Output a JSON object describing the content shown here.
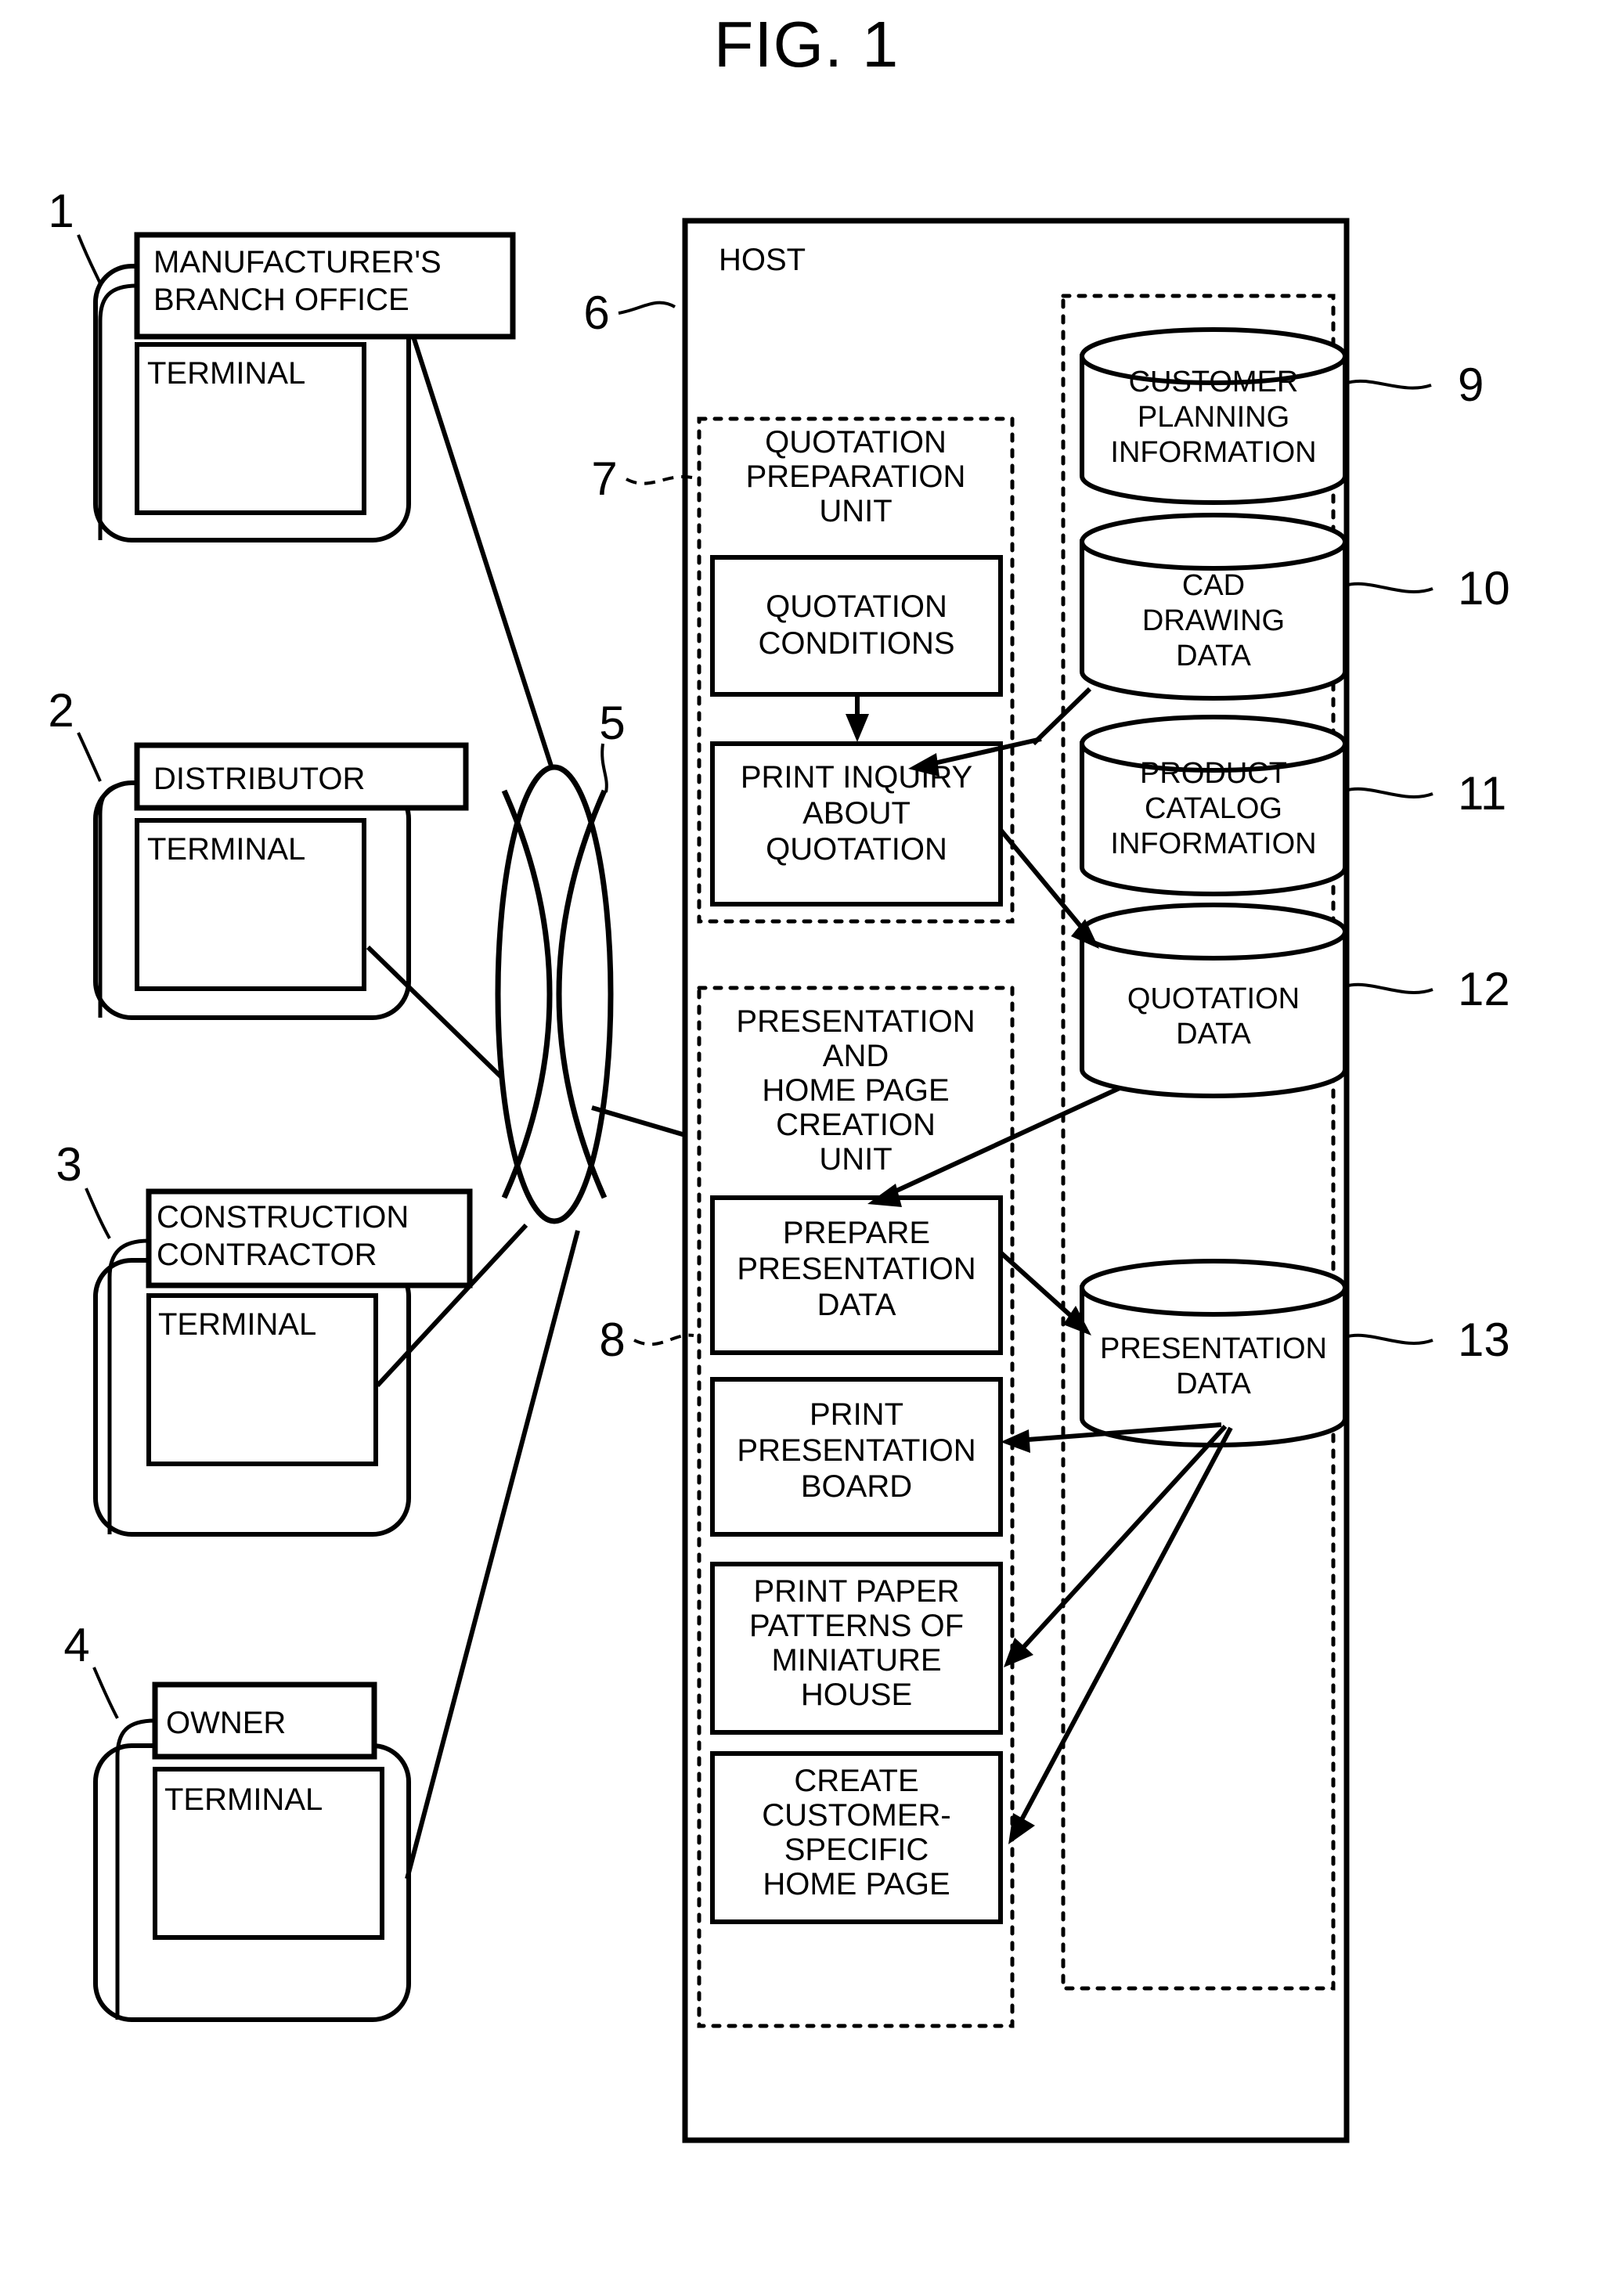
{
  "figure": {
    "title": "FIG. 1"
  },
  "actors": [
    {
      "ref": "1",
      "name": "MANUFACTURER'S BRANCH OFFICE",
      "name_line1": "MANUFACTURER'S",
      "name_line2": "BRANCH OFFICE",
      "terminal": "TERMINAL"
    },
    {
      "ref": "2",
      "name": "DISTRIBUTOR",
      "name_line1": "DISTRIBUTOR",
      "name_line2": "",
      "terminal": "TERMINAL"
    },
    {
      "ref": "3",
      "name": "CONSTRUCTION CONTRACTOR",
      "name_line1": "CONSTRUCTION",
      "name_line2": "CONTRACTOR",
      "terminal": "TERMINAL"
    },
    {
      "ref": "4",
      "name": "OWNER",
      "name_line1": "OWNER",
      "name_line2": "",
      "terminal": "TERMINAL"
    }
  ],
  "network": {
    "ref": "5",
    "label": ""
  },
  "host": {
    "ref": "6",
    "label": "HOST",
    "units": [
      {
        "ref": "7",
        "title_lines": [
          "QUOTATION",
          "PREPARATION",
          "UNIT"
        ],
        "steps": [
          {
            "lines": [
              "QUOTATION",
              "CONDITIONS"
            ]
          },
          {
            "lines": [
              "PRINT INQUIRY",
              "ABOUT",
              "QUOTATION"
            ]
          }
        ]
      },
      {
        "ref": "8",
        "title_lines": [
          "PRESENTATION",
          "AND",
          "HOME PAGE",
          "CREATION",
          "UNIT"
        ],
        "steps": [
          {
            "lines": [
              "PREPARE",
              "PRESENTATION",
              "DATA"
            ]
          },
          {
            "lines": [
              "PRINT",
              "PRESENTATION",
              "BOARD"
            ]
          },
          {
            "lines": [
              "PRINT PAPER",
              "PATTERNS OF",
              "MINIATURE",
              "HOUSE"
            ]
          },
          {
            "lines": [
              "CREATE",
              "CUSTOMER-",
              "SPECIFIC",
              "HOME PAGE"
            ]
          }
        ]
      }
    ],
    "databases": [
      {
        "ref": "9",
        "lines": [
          "CUSTOMER",
          "PLANNING",
          "INFORMATION"
        ]
      },
      {
        "ref": "10",
        "lines": [
          "CAD",
          "DRAWING",
          "DATA"
        ]
      },
      {
        "ref": "11",
        "lines": [
          "PRODUCT",
          "CATALOG",
          "INFORMATION"
        ]
      },
      {
        "ref": "12",
        "lines": [
          "QUOTATION",
          "DATA"
        ]
      },
      {
        "ref": "13",
        "lines": [
          "PRESENTATION",
          "DATA"
        ]
      }
    ]
  },
  "colors": {
    "stroke": "#000000",
    "background": "#ffffff"
  }
}
